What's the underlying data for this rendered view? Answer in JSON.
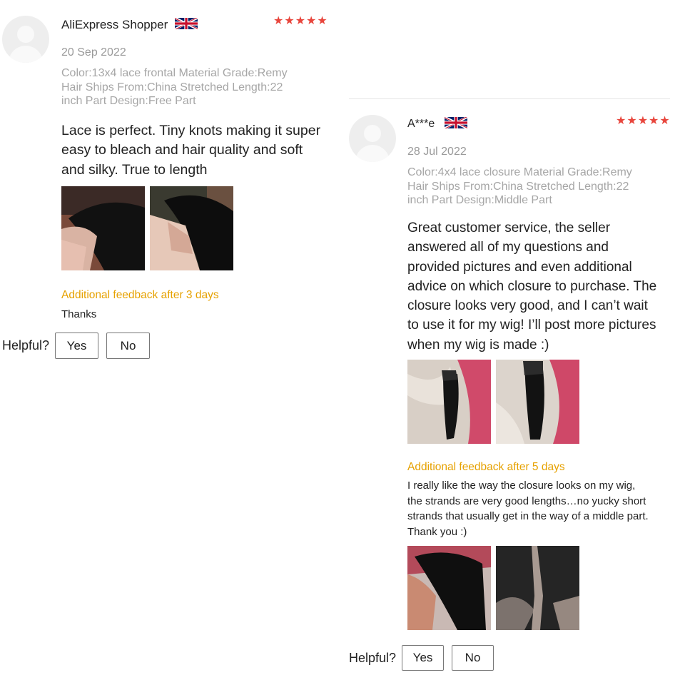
{
  "reviews": [
    {
      "reviewer": "AliExpress Shopper",
      "country_flag": "uk-flag-icon",
      "rating": "★★★★★",
      "date": "20 Sep 2022",
      "spec_lines": [
        "Color:13x4 lace frontal Material Grade:Remy",
        "Hair Ships From:China Stretched Length:22",
        "inch Part Design:Free Part"
      ],
      "body_lines": [
        "Lace is perfect. Tiny knots making it super",
        "easy to bleach and hair quality and soft",
        "and silky. True to length"
      ],
      "photos": [
        "lace-front-photo",
        "lace-front-photo"
      ],
      "feedback_title": "Additional feedback after 3 days",
      "feedback_lines": [
        "Thanks"
      ],
      "feedback_photos": [],
      "helpful_label": "Helpful?",
      "yes_label": "Yes",
      "no_label": "No"
    },
    {
      "reviewer": "A***e",
      "country_flag": "uk-flag-icon",
      "rating": "★★★★★",
      "date": "28 Jul 2022",
      "spec_lines": [
        "Color:4x4 lace closure Material Grade:Remy",
        "Hair Ships From:China Stretched Length:22",
        "inch Part Design:Middle Part"
      ],
      "body_lines": [
        "Great customer service, the seller",
        "answered all of my questions and",
        "provided pictures and even additional",
        "advice on which closure to purchase. The",
        "closure looks very good, and I can’t wait",
        "to use it for my wig! I’ll post more pictures",
        "when my wig is made :)"
      ],
      "photos": [
        "closure-bundle-photo",
        "closure-bundle-photo"
      ],
      "feedback_title": "Additional feedback after 5 days",
      "feedback_lines": [
        "I really like the way the closure looks on my wig,",
        "the strands are very good lengths…no yucky short",
        "strands that usually get in the way of a middle part.",
        "Thank you :)"
      ],
      "feedback_photos": [
        "wig-worn-photo",
        "middle-part-photo"
      ],
      "helpful_label": "Helpful?",
      "yes_label": "Yes",
      "no_label": "No"
    }
  ],
  "colors": {
    "star": "#e8453c",
    "feedback_title": "#e6a100",
    "meta": "#9a9a9a"
  }
}
